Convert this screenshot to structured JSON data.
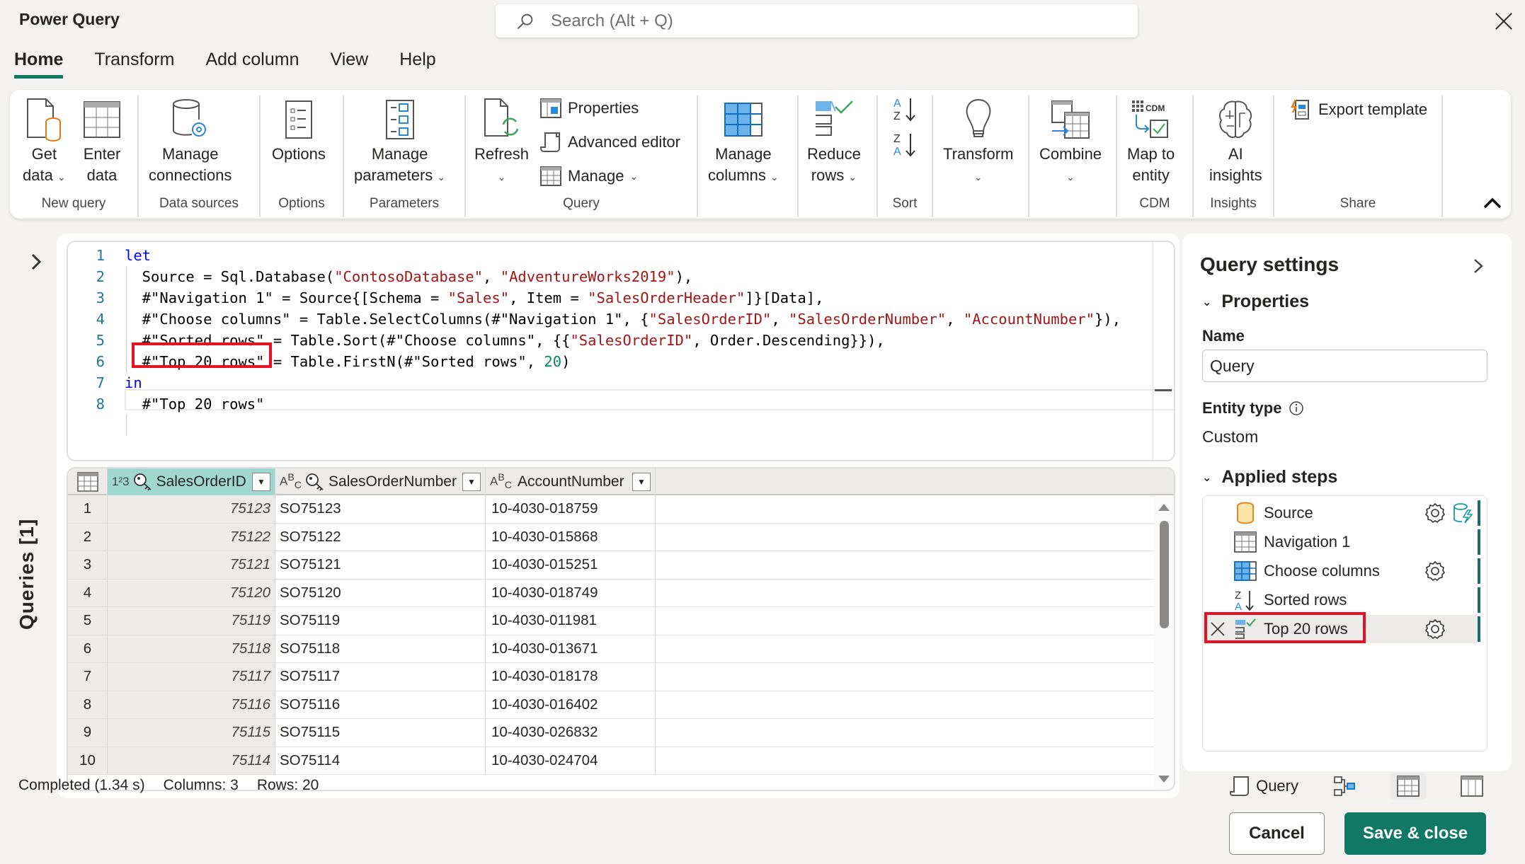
{
  "app": {
    "title": "Power Query"
  },
  "search": {
    "placeholder": "Search (Alt + Q)"
  },
  "tabs": [
    {
      "label": "Home",
      "active": true
    },
    {
      "label": "Transform"
    },
    {
      "label": "Add column"
    },
    {
      "label": "View"
    },
    {
      "label": "Help"
    }
  ],
  "ribbon": {
    "groups": {
      "new_query": "New query",
      "data_sources": "Data sources",
      "options": "Options",
      "parameters": "Parameters",
      "query": "Query",
      "sort": "Sort",
      "cdm": "CDM",
      "insights": "Insights",
      "share": "Share"
    },
    "buttons": {
      "get_data": [
        "Get",
        "data"
      ],
      "enter_data": [
        "Enter",
        "data"
      ],
      "manage_connections": [
        "Manage",
        "connections"
      ],
      "options": "Options",
      "manage_parameters": [
        "Manage",
        "parameters"
      ],
      "refresh": "Refresh",
      "properties": "Properties",
      "advanced_editor": "Advanced editor",
      "manage": "Manage",
      "manage_columns": [
        "Manage",
        "columns"
      ],
      "reduce_rows": [
        "Reduce",
        "rows"
      ],
      "transform": "Transform",
      "combine": "Combine",
      "map_to_entity": [
        "Map to",
        "entity"
      ],
      "ai_insights": [
        "AI",
        "insights"
      ],
      "export_template": "Export template"
    }
  },
  "queries_pane": {
    "label": "Queries [1]"
  },
  "editor": {
    "lines": [
      {
        "n": "1",
        "tokens": [
          [
            "kw",
            "let"
          ]
        ]
      },
      {
        "n": "2",
        "tokens": [
          [
            "txt",
            "  Source = Sql.Database("
          ],
          [
            "str",
            "\"ContosoDatabase\""
          ],
          [
            "txt",
            ", "
          ],
          [
            "str",
            "\"AdventureWorks2019\""
          ],
          [
            "txt",
            "),"
          ]
        ]
      },
      {
        "n": "3",
        "tokens": [
          [
            "txt",
            "  #\"Navigation 1\" = Source{[Schema = "
          ],
          [
            "str",
            "\"Sales\""
          ],
          [
            "txt",
            ", Item = "
          ],
          [
            "str",
            "\"SalesOrderHeader\""
          ],
          [
            "txt",
            "]}[Data],"
          ]
        ]
      },
      {
        "n": "4",
        "tokens": [
          [
            "txt",
            "  #\"Choose columns\" = Table.SelectColumns(#\"Navigation 1\", {"
          ],
          [
            "str",
            "\"SalesOrderID\""
          ],
          [
            "txt",
            ", "
          ],
          [
            "str",
            "\"SalesOrderNumber\""
          ],
          [
            "txt",
            ", "
          ],
          [
            "str",
            "\"AccountNumber\""
          ],
          [
            "txt",
            "}),"
          ]
        ]
      },
      {
        "n": "5",
        "tokens": [
          [
            "txt",
            "  #\"Sorted rows\" = Table.Sort(#\"Choose columns\", {{"
          ],
          [
            "str",
            "\"SalesOrderID\""
          ],
          [
            "txt",
            ", Order.Descending}}),"
          ]
        ]
      },
      {
        "n": "6",
        "tokens": [
          [
            "txt",
            "  #\"Top 20 rows\" = Table.FirstN(#\"Sorted rows\", "
          ],
          [
            "num",
            "20"
          ],
          [
            "txt",
            ")"
          ]
        ]
      },
      {
        "n": "7",
        "tokens": [
          [
            "kw",
            "in"
          ]
        ]
      },
      {
        "n": "8",
        "tokens": [
          [
            "txt",
            "  #\"Top 20 rows\""
          ]
        ]
      }
    ]
  },
  "grid": {
    "columns": [
      {
        "name": "SalesOrderID",
        "type": "1²3",
        "key": true
      },
      {
        "name": "SalesOrderNumber",
        "type": "ABC",
        "key": true
      },
      {
        "name": "AccountNumber",
        "type": "ABC",
        "key": false
      }
    ],
    "rows": [
      [
        "1",
        "75123",
        "SO75123",
        "10-4030-018759"
      ],
      [
        "2",
        "75122",
        "SO75122",
        "10-4030-015868"
      ],
      [
        "3",
        "75121",
        "SO75121",
        "10-4030-015251"
      ],
      [
        "4",
        "75120",
        "SO75120",
        "10-4030-018749"
      ],
      [
        "5",
        "75119",
        "SO75119",
        "10-4030-011981"
      ],
      [
        "6",
        "75118",
        "SO75118",
        "10-4030-013671"
      ],
      [
        "7",
        "75117",
        "SO75117",
        "10-4030-018178"
      ],
      [
        "8",
        "75116",
        "SO75116",
        "10-4030-016402"
      ],
      [
        "9",
        "75115",
        "SO75115",
        "10-4030-026832"
      ],
      [
        "10",
        "75114",
        "SO75114",
        "10-4030-024704"
      ]
    ]
  },
  "status": {
    "completed": "Completed (1.34 s)",
    "columns": "Columns: 3",
    "rows": "Rows: 20",
    "query_view": "Query"
  },
  "settings": {
    "title": "Query settings",
    "properties_label": "Properties",
    "name_label": "Name",
    "name_value": "Query",
    "entity_type_label": "Entity type",
    "entity_type_value": "Custom",
    "applied_steps_label": "Applied steps",
    "steps": [
      {
        "label": "Source",
        "icon": "database-icon",
        "gear": true,
        "extra": true
      },
      {
        "label": "Navigation 1",
        "icon": "table-icon",
        "gear": false
      },
      {
        "label": "Choose columns",
        "icon": "choose-columns-icon",
        "gear": true
      },
      {
        "label": "Sorted rows",
        "icon": "sort-desc-icon",
        "gear": false
      },
      {
        "label": "Top 20 rows",
        "icon": "reduce-rows-icon",
        "gear": true,
        "selected": true
      }
    ]
  },
  "footer": {
    "cancel": "Cancel",
    "save": "Save & close"
  },
  "colors": {
    "accent": "#117865",
    "highlight": "#e81123",
    "selected_column": "#a0d8cf"
  }
}
